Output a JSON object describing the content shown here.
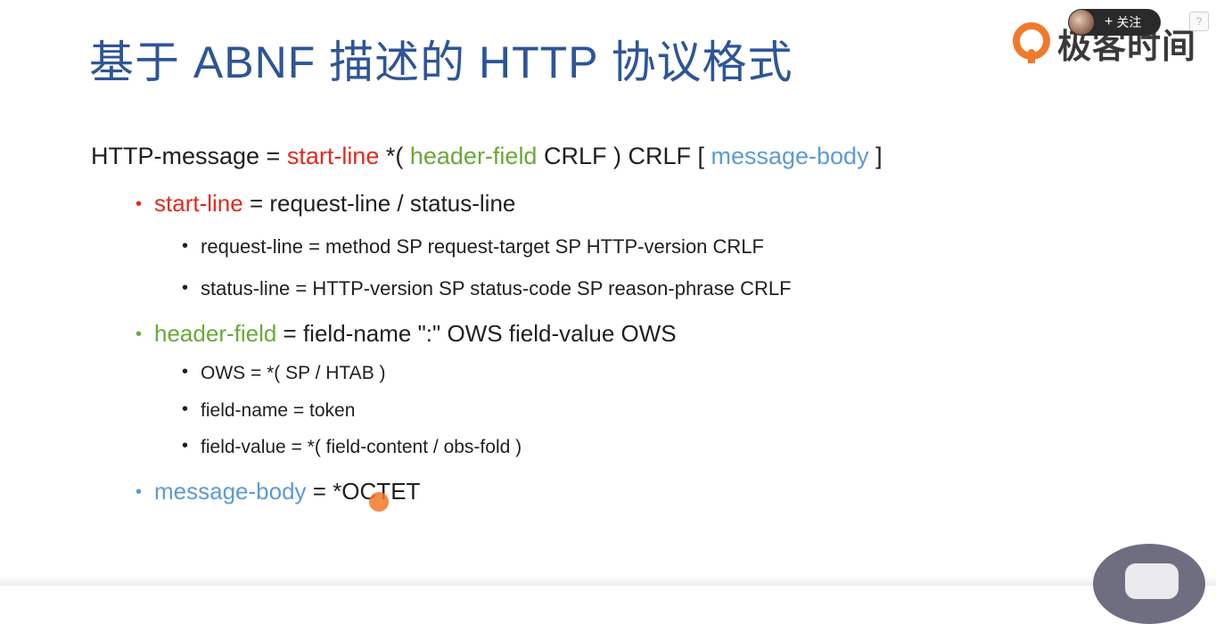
{
  "title": "基于 ABNF 描述的 HTTP 协议格式",
  "overlay": {
    "follow_label": "关注",
    "follow_plus": "+",
    "help": "?",
    "logo_text": "极客时间",
    "brand_color": "#f07a2b"
  },
  "colors": {
    "title": "#2e5597",
    "red": "#e02b20",
    "green": "#6aa839",
    "blue": "#5b9bd5"
  },
  "rule0": {
    "a": "HTTP-message = ",
    "b": "start-line",
    "c": " *( ",
    "d": "header-field",
    "e": " CRLF ) CRLF [ ",
    "f": "message-body",
    "g": " ]"
  },
  "rule1": {
    "bullet": "•",
    "term": "start-line",
    "rest": " = request-line / status-line"
  },
  "rule1a": {
    "bullet": "•",
    "text": "request-line = method SP request-target SP HTTP-version CRLF"
  },
  "rule1b": {
    "bullet": "•",
    "text": "status-line = HTTP-version SP status-code SP reason-phrase CRLF"
  },
  "rule2": {
    "bullet": "•",
    "term": "header-field",
    "rest": " = field-name \":\" OWS field-value OWS"
  },
  "rule2a": {
    "bullet": "•",
    "text": "OWS = *( SP / HTAB )"
  },
  "rule2b": {
    "bullet": "•",
    "text": "field-name = token"
  },
  "rule2c": {
    "bullet": "•",
    "text": "field-value = *( field-content / obs-fold )"
  },
  "rule3": {
    "bullet": "•",
    "term": "message-body",
    "rest": " = *OCTET"
  }
}
